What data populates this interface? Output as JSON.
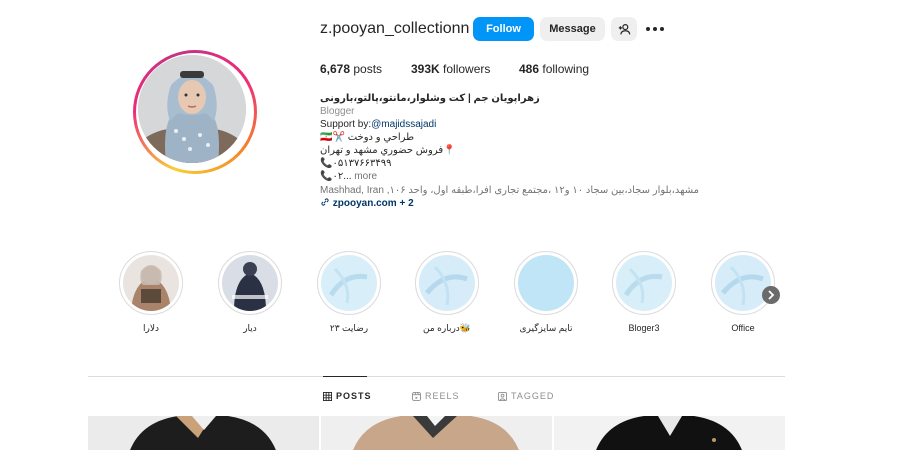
{
  "profile": {
    "username": "z.pooyan_collectionn",
    "follow_label": "Follow",
    "message_label": "Message",
    "suggest_icon": "person-plus-icon",
    "more_icon": "more-options-icon"
  },
  "stats": {
    "posts_count": "6,678",
    "posts_label": "posts",
    "followers_count": "393K",
    "followers_label": "followers",
    "following_count": "486",
    "following_label": "following"
  },
  "bio": {
    "name": "زهراپویان جم | کت وشلوار،مانتو،پالتو،بارونی",
    "category": "Blogger",
    "support_prefix": "Support by:",
    "support_mention": "@majidssajadi",
    "line_design": "طراحي و دوخت",
    "line_sales": "فروش حضوري مشهد و تهران",
    "phone_1": "۰۵۱۳۷۶۶۳۴۹۹",
    "phone_2": "۰۲...",
    "more_label": " more",
    "address": "Mashhad, Iran ,مشهد،بلوار سجاد،بین سجاد ۱۰ و۱۲ ،مجتمع تجاری افرا،طبقه اول، واحد ۱۰۶",
    "link_text": "zpooyan.com",
    "link_more": " + 2"
  },
  "highlights": [
    {
      "label": "دلارا"
    },
    {
      "label": "دیار"
    },
    {
      "label": "رضایت ۲۳"
    },
    {
      "label": "درباره من🐝"
    },
    {
      "label": "تایم سایزگیری"
    },
    {
      "label": "Bloger3"
    },
    {
      "label": "Office"
    }
  ],
  "tabs": {
    "posts": "POSTS",
    "reels": "REELS",
    "tagged": "TAGGED"
  },
  "colors": {
    "accent": "#0095f6",
    "text": "#262626",
    "muted": "#8e8e8e",
    "link": "#00376b"
  }
}
